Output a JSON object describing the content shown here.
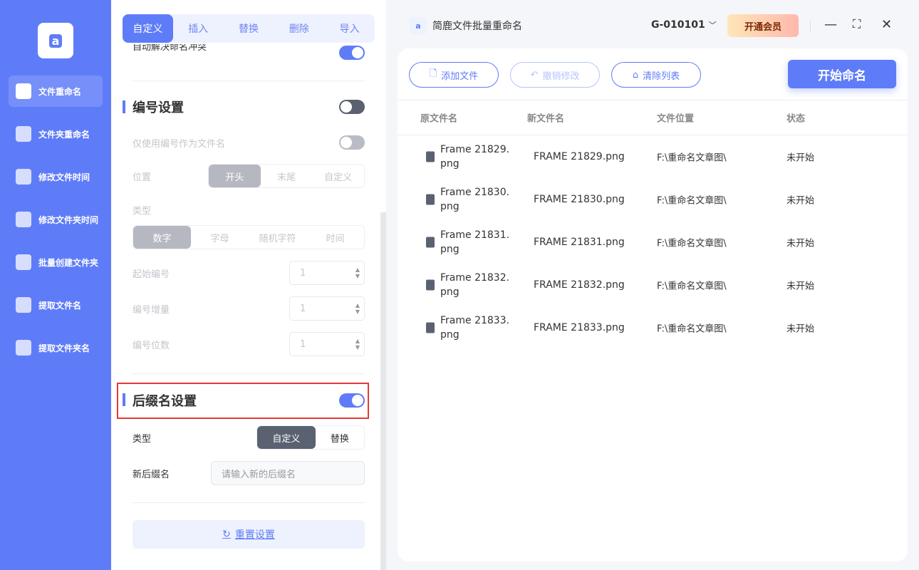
{
  "sidebar": {
    "logo": "a",
    "items": [
      {
        "label": "文件重命名"
      },
      {
        "label": "文件夹重命名"
      },
      {
        "label": "修改文件时间"
      },
      {
        "label": "修改文件夹时间"
      },
      {
        "label": "批量创建文件夹"
      },
      {
        "label": "提取文件名"
      },
      {
        "label": "提取文件夹名"
      }
    ]
  },
  "settings": {
    "tabs": [
      "自定义",
      "插入",
      "替换",
      "删除",
      "导入"
    ],
    "clipped_text": "自动解决命名冲突",
    "numbering": {
      "title": "编号设置",
      "only_number_label": "仅使用编号作为文件名",
      "position_label": "位置",
      "positions": [
        "开头",
        "末尾",
        "自定义"
      ],
      "type_label": "类型",
      "types": [
        "数字",
        "字母",
        "随机字符",
        "时间"
      ],
      "start_label": "起始编号",
      "start_value": "1",
      "step_label": "编号增量",
      "step_value": "1",
      "digits_label": "编号位数",
      "digits_value": "1"
    },
    "suffix": {
      "title": "后缀名设置",
      "type_label": "类型",
      "types": [
        "自定义",
        "替换"
      ],
      "new_label": "新后缀名",
      "new_placeholder": "请输入新的后缀名"
    },
    "reset_label": "重置设置"
  },
  "app": {
    "title": "简鹿文件批量重命名",
    "user": "G-010101",
    "vip": "开通会员"
  },
  "toolbar": {
    "add": "添加文件",
    "undo": "撤销修改",
    "clear": "清除列表",
    "start": "开始命名"
  },
  "table": {
    "headers": [
      "原文件名",
      "新文件名",
      "文件位置",
      "状态"
    ],
    "rows": [
      {
        "orig1": "Frame 21829.",
        "orig2": "png",
        "new": "FRAME 21829.png",
        "loc": "F:\\重命名文章图\\",
        "status": "未开始"
      },
      {
        "orig1": "Frame 21830.",
        "orig2": "png",
        "new": "FRAME 21830.png",
        "loc": "F:\\重命名文章图\\",
        "status": "未开始"
      },
      {
        "orig1": "Frame 21831.",
        "orig2": "png",
        "new": "FRAME 21831.png",
        "loc": "F:\\重命名文章图\\",
        "status": "未开始"
      },
      {
        "orig1": "Frame 21832.",
        "orig2": "png",
        "new": "FRAME 21832.png",
        "loc": "F:\\重命名文章图\\",
        "status": "未开始"
      },
      {
        "orig1": "Frame 21833.",
        "orig2": "png",
        "new": "FRAME 21833.png",
        "loc": "F:\\重命名文章图\\",
        "status": "未开始"
      }
    ]
  }
}
